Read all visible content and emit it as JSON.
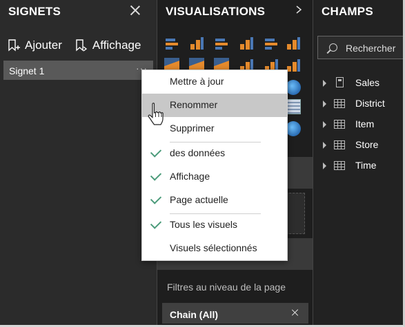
{
  "signets": {
    "title": "SIGNETS",
    "add_label": "Ajouter",
    "view_label": "Affichage",
    "bookmarks": [
      {
        "label": "Signet 1",
        "more": "···"
      }
    ]
  },
  "visualisations": {
    "title": "VISUALISATIONS",
    "filters_label": "Filtres au niveau de la page",
    "filter_chip": {
      "label": "Chain",
      "value": "(All)"
    }
  },
  "champs": {
    "title": "CHAMPS",
    "search_placeholder": "Rechercher",
    "fields": [
      {
        "label": "Sales",
        "icon": "calculator-icon"
      },
      {
        "label": "District",
        "icon": "table-icon"
      },
      {
        "label": "Item",
        "icon": "table-icon"
      },
      {
        "label": "Store",
        "icon": "table-icon"
      },
      {
        "label": "Time",
        "icon": "table-icon"
      }
    ]
  },
  "context_menu": {
    "items": [
      {
        "label": "Mettre à jour",
        "checked": false
      },
      {
        "label": "Renommer",
        "checked": false,
        "hovered": true
      },
      {
        "label": "Supprimer",
        "checked": false
      },
      {
        "label": "des données",
        "checked": true
      },
      {
        "label": "Affichage",
        "checked": true
      },
      {
        "label": "Page actuelle",
        "checked": true
      },
      {
        "label": "Tous les visuels",
        "checked": true
      },
      {
        "label": "Visuels sélectionnés",
        "checked": false
      }
    ]
  },
  "colors": {
    "accent_check": "#4b9b7a",
    "hover_row": "#c8c8c8",
    "panel_dark": "#2b2b2b"
  }
}
